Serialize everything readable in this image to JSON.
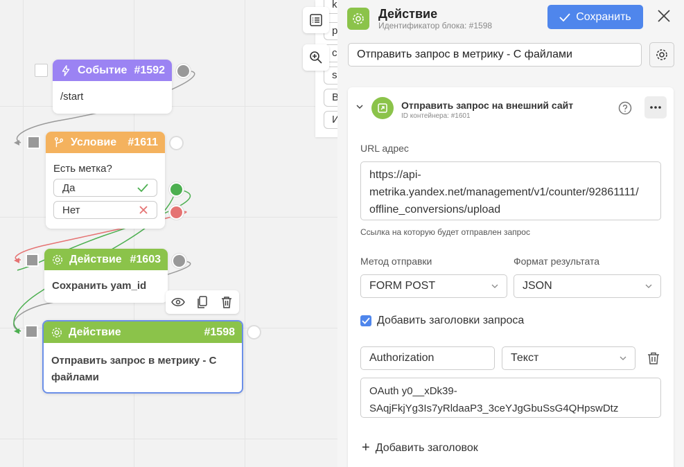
{
  "nodes": {
    "event": {
      "title": "Событие",
      "id": "#1592",
      "text": "/start"
    },
    "condition": {
      "title": "Условие",
      "id": "#1611",
      "question": "Есть метка?",
      "yes": "Да",
      "no": "Нет"
    },
    "action1": {
      "title": "Действие",
      "id": "#1603",
      "text": "Сохранить yam_id"
    },
    "action2": {
      "title": "Действие",
      "id": "#1598",
      "text": "Отправить запрос в метрику - С файлами"
    }
  },
  "behind_list": [
    "k",
    "p",
    "c",
    "s",
    "B",
    "И"
  ],
  "panel": {
    "title": "Действие",
    "subtitle": "Идентификатор блока: #1598",
    "save_label": "Сохранить",
    "name_value": "Отправить запрос в метрику - С файлами",
    "card": {
      "title": "Отправить запрос на внешний сайт",
      "subtitle": "ID контейнера: #1601",
      "url_label": "URL адрес",
      "url_lines": [
        "https://api-",
        "metrika.yandex.net/management/v1/counter/92861111/",
        "offline_conversions/upload"
      ],
      "url_hint": "Ссылка на которую будет отправлен запрос",
      "method_label": "Метод отправки",
      "method_value": "FORM POST",
      "format_label": "Формат результата",
      "format_value": "JSON",
      "headers_checkbox_label": "Добавить заголовки запроса",
      "header_name": "Authorization",
      "header_type": "Текст",
      "header_value_lines": [
        "OAuth y0__xDk39-",
        "SAqjFkjYg3Is7yRldaaP3_3ceYJgGbuSsG4QHpswDtz"
      ],
      "add_header_label": "Добавить заголовок"
    }
  },
  "colors": {
    "event": "#9b83f3",
    "condition": "#f4b25e",
    "action": "#8bc34a",
    "accent": "#4f86ec"
  }
}
